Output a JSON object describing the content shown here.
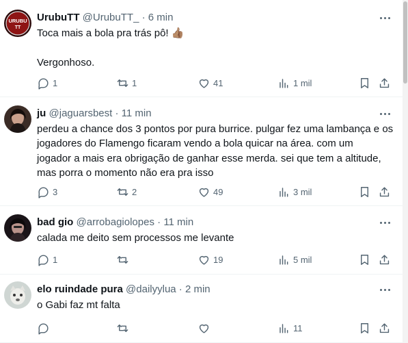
{
  "tweets": [
    {
      "name": "UrubuTT",
      "handle": "@UrubuTT_",
      "separator": "·",
      "time": "6 min",
      "text": "Toca mais a bola pra trás pô! 👍🏽\n\nVergonhoso.",
      "avatar_text": "URUBU\nTT",
      "replies": "1",
      "retweets": "1",
      "likes": "41",
      "views": "1 mil"
    },
    {
      "name": "ju",
      "handle": "@jaguarsbest",
      "separator": "·",
      "time": "11 min",
      "text": "perdeu a chance dos 3 pontos por pura burrice. pulgar fez uma lambança e os\njogadores do Flamengo ficaram vendo a bola quicar na área. com um\njogador a mais era obrigação de ganhar esse merda. sei que tem a altitude,\nmas porra o momento não era pra isso",
      "replies": "3",
      "retweets": "2",
      "likes": "49",
      "views": "3 mil"
    },
    {
      "name": "bad gio",
      "handle": "@arrobagiolopes",
      "separator": "·",
      "time": "11 min",
      "text": "calada me deito sem processos me levante",
      "replies": "1",
      "retweets": "",
      "likes": "19",
      "views": "5 mil"
    },
    {
      "name": "elo ruindade pura",
      "handle": "@dailyylua",
      "separator": "·",
      "time": "2 min",
      "text": "o Gabi faz mt falta",
      "replies": "",
      "retweets": "",
      "likes": "",
      "views": "11"
    }
  ],
  "colors": {
    "text": "#0f1419",
    "secondary": "#536471",
    "divider": "#eff3f4"
  },
  "icons": [
    "reply-icon",
    "retweet-icon",
    "like-icon",
    "views-icon",
    "bookmark-icon",
    "share-icon",
    "more-icon"
  ]
}
